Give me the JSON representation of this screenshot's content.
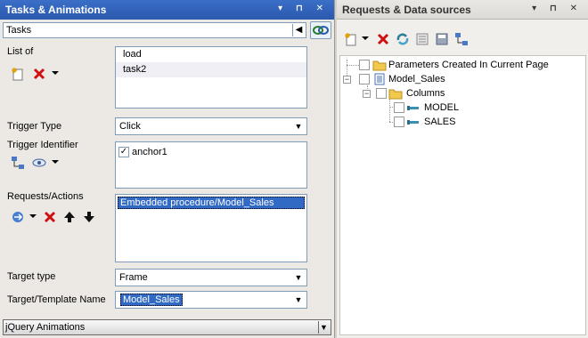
{
  "left_panel": {
    "title": "Tasks & Animations",
    "title_buttons": "▾ ⊓ ✕",
    "tasks_dropdown_value": "Tasks",
    "list_of": {
      "label": "List of",
      "items": [
        "load",
        "task2"
      ]
    },
    "trigger_type": {
      "label": "Trigger Type",
      "value": "Click"
    },
    "trigger_identifier": {
      "label": "Trigger Identifier",
      "items": [
        {
          "label": "anchor1",
          "checked": true
        }
      ]
    },
    "requests_actions": {
      "label": "Requests/Actions",
      "items": [
        "Embedded procedure/Model_Sales"
      ]
    },
    "target_type": {
      "label": "Target type",
      "value": "Frame"
    },
    "target_template_name": {
      "label": "Target/Template Name",
      "value": "Model_Sales"
    },
    "jquery_bar": {
      "label": "jQuery Animations"
    }
  },
  "right_panel": {
    "title": "Requests & Data sources",
    "title_buttons": "▾ ⊓ ✕",
    "tree": [
      {
        "label": "Parameters Created In Current Page",
        "icon": "folder-icon"
      },
      {
        "label": "Model_Sales",
        "icon": "document-icon"
      },
      {
        "label": "Columns",
        "icon": "folder-icon"
      },
      {
        "label": "MODEL",
        "icon": "field-icon"
      },
      {
        "label": "SALES",
        "icon": "field-icon"
      }
    ]
  },
  "colors": {
    "active_title": "#2a59ad",
    "selection": "#316ac5",
    "delete_red": "#d01010",
    "folder_yellow": "#f2c94c"
  }
}
